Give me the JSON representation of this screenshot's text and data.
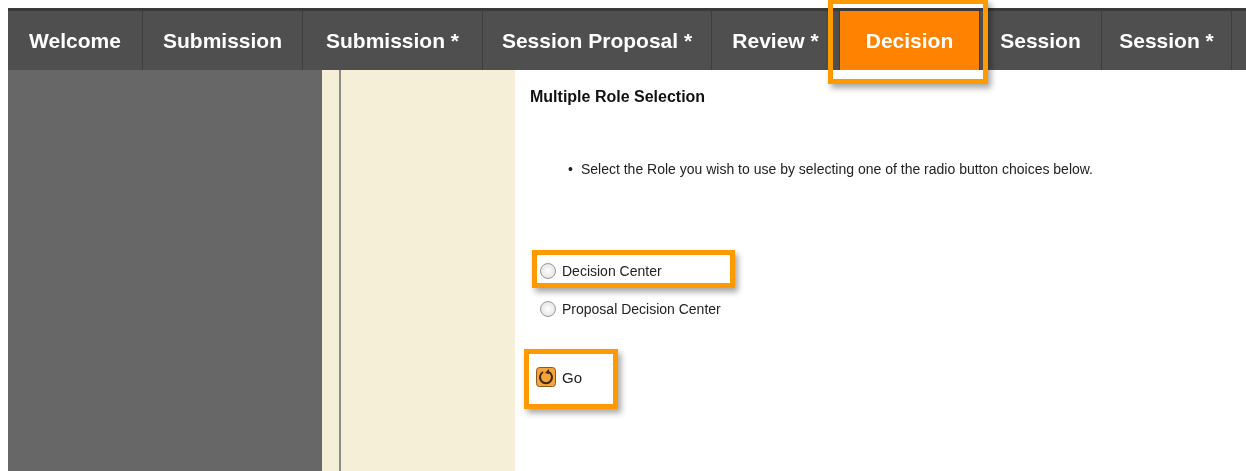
{
  "tabs": [
    {
      "label": "Welcome",
      "selected": false,
      "highlighted": false
    },
    {
      "label": "Submission",
      "selected": false,
      "highlighted": false
    },
    {
      "label": "Submission *",
      "selected": false,
      "highlighted": false
    },
    {
      "label": "Session Proposal *",
      "selected": false,
      "highlighted": false
    },
    {
      "label": "Review *",
      "selected": false,
      "highlighted": false
    },
    {
      "label": "Decision",
      "selected": true,
      "highlighted": true
    },
    {
      "label": "Session",
      "selected": false,
      "highlighted": false
    },
    {
      "label": "Session *",
      "selected": false,
      "highlighted": false
    }
  ],
  "heading": "Multiple Role Selection",
  "instructions": [
    {
      "marker": "•",
      "text": "Select the Role you wish to use by selecting one of the radio button choices below."
    }
  ],
  "roles": [
    {
      "label": "Decision Center",
      "selected": false,
      "highlighted": true
    },
    {
      "label": "Proposal Decision Center",
      "selected": false,
      "highlighted": false
    }
  ],
  "go_button": {
    "label": "Go",
    "highlighted": true
  }
}
